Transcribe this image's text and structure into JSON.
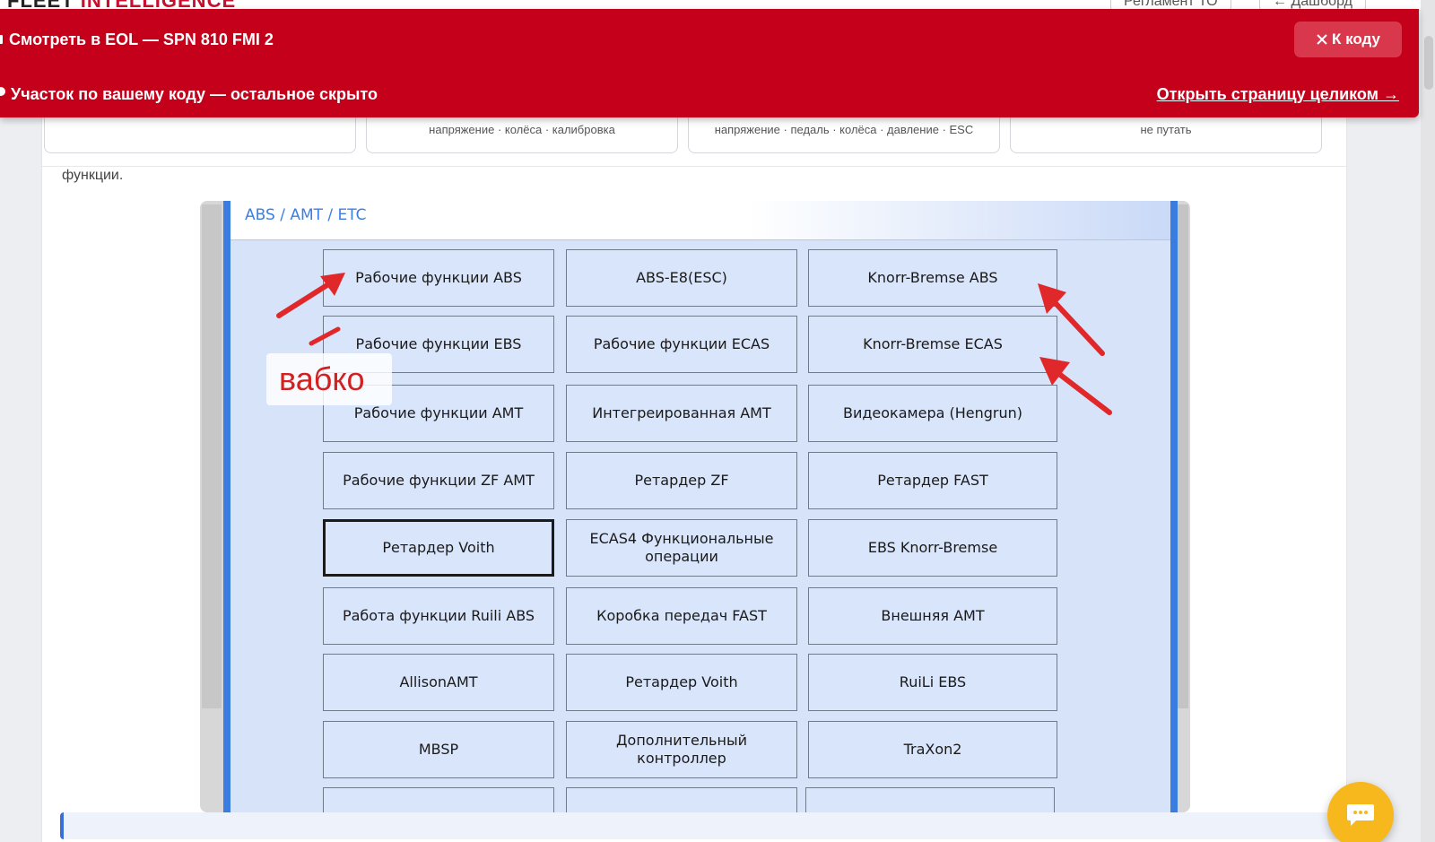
{
  "app": {
    "logo_main": "FLEET",
    "logo_accent": "INTELLIGENCE",
    "nav_items": [
      "Регламент ТО",
      "← Дашборд"
    ]
  },
  "banner": {
    "title": "Смотреть в EOL — SPN 810 FMI 2",
    "subtitle": "Участок по вашему коду — остальное скрыто",
    "back_label": "К коду",
    "open_link": "Открыть страницу целиком →",
    "bg_color": "#c4001a"
  },
  "chips": [
    {
      "text": ""
    },
    {
      "text": "напряжение · колёса · калибровка"
    },
    {
      "text": "напряжение · педаль · колёса · давление · ESC"
    },
    {
      "text": "не путать"
    }
  ],
  "content": {
    "intro_text": "функции."
  },
  "screenshot": {
    "title": "ABS / AMT / ETC",
    "overlay_text": "вабко",
    "buttons": [
      [
        "Рабочие функции ABS",
        "ABS-E8(ESC)",
        "Knorr-Bremse ABS"
      ],
      [
        "Рабочие функции EBS",
        "Рабочие функции ECAS",
        "Knorr-Bremse ECAS"
      ],
      [
        "Рабочие функции AMT",
        "Интегреированная AMT",
        "Видеокамера (Hengrun)"
      ],
      [
        "Рабочие функции ZF AMT",
        "Ретардер ZF",
        "Ретардер FAST"
      ],
      [
        "Ретардер Voith",
        "ECAS4 Функциональные операции",
        "EBS Knorr-Bremse"
      ],
      [
        "Работа функции Ruili ABS",
        "Коробка передач FAST",
        "Внешняя AMT"
      ],
      [
        "AllisonAMT",
        "Ретардер Voith",
        "RuiLi EBS"
      ],
      [
        "MBSP",
        "Дополнительный контроллер",
        "TraXon2"
      ]
    ],
    "selected_button": "Ретардер Voith"
  },
  "chat": {
    "icon": "chat-bubble-icon",
    "color": "#f6b81c"
  }
}
